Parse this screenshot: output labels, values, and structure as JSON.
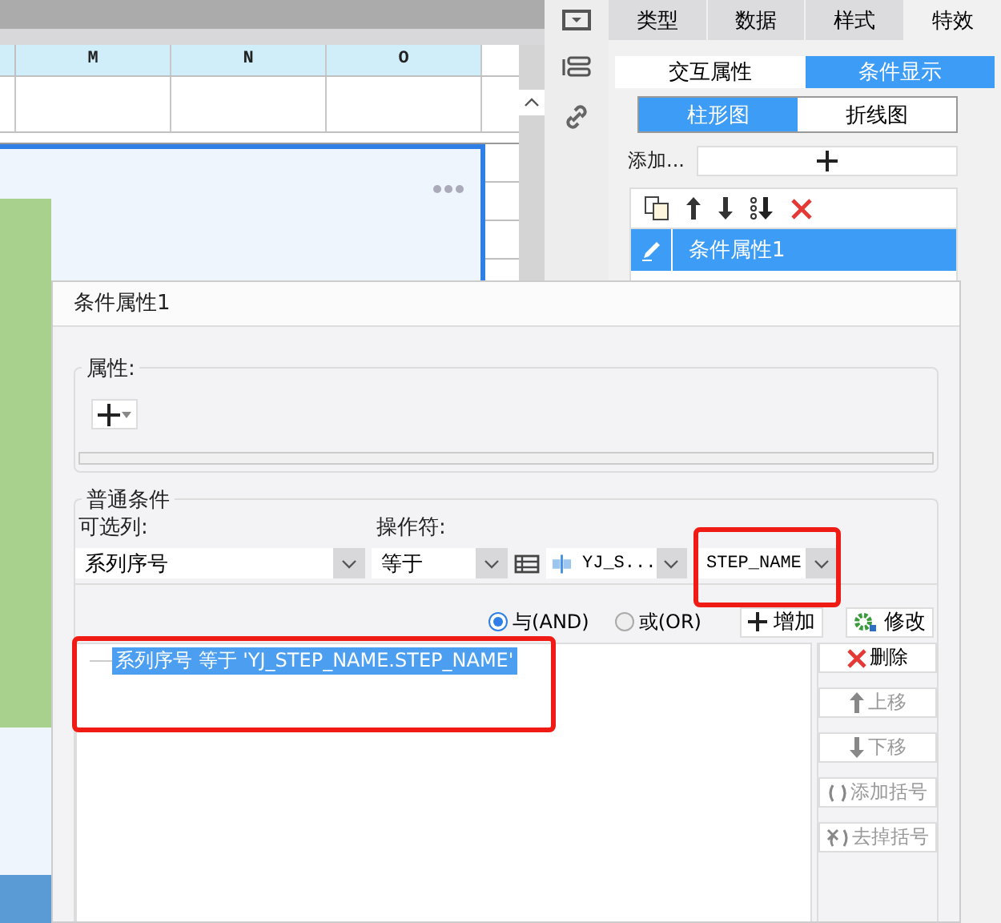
{
  "spreadsheet": {
    "columns": [
      "M",
      "N",
      "O"
    ]
  },
  "panel": {
    "tabs": [
      {
        "label": "类型",
        "selected": false
      },
      {
        "label": "数据",
        "selected": false
      },
      {
        "label": "样式",
        "selected": false
      },
      {
        "label": "特效",
        "selected": true
      }
    ],
    "mode_tabs": [
      {
        "label": "交互属性",
        "selected": false
      },
      {
        "label": "条件显示",
        "selected": true
      }
    ],
    "chart_tabs": [
      {
        "label": "柱形图",
        "selected": true
      },
      {
        "label": "折线图",
        "selected": false
      }
    ],
    "add_label": "添加...",
    "conditions": [
      {
        "label": "条件属性1",
        "selected": true
      }
    ]
  },
  "dialog": {
    "title": "条件属性1",
    "attributes": {
      "legend": "属性:"
    },
    "general": {
      "legend": "普通条件",
      "column_label": "可选列:",
      "column_value": "系列序号",
      "operator_label": "操作符:",
      "operator_value": "等于",
      "field_value": "YJ_S...",
      "field2_value": "STEP_NAME"
    },
    "logic": [
      {
        "label": "与(AND)",
        "selected": true
      },
      {
        "label": "或(OR)",
        "selected": false
      }
    ],
    "add_button": "增加",
    "edit_button": "修改",
    "conditions": [
      {
        "text": "系列序号 等于 'YJ_STEP_NAME.STEP_NAME'",
        "selected": true
      }
    ],
    "actions": [
      {
        "label": "删除",
        "kind": "delete",
        "disabled": false
      },
      {
        "label": "上移",
        "kind": "up",
        "disabled": true
      },
      {
        "label": "下移",
        "kind": "down",
        "disabled": true
      },
      {
        "label": "添加括号",
        "kind": "add-parens",
        "disabled": true
      },
      {
        "label": "去掉括号",
        "kind": "remove-parens",
        "disabled": true
      }
    ]
  }
}
